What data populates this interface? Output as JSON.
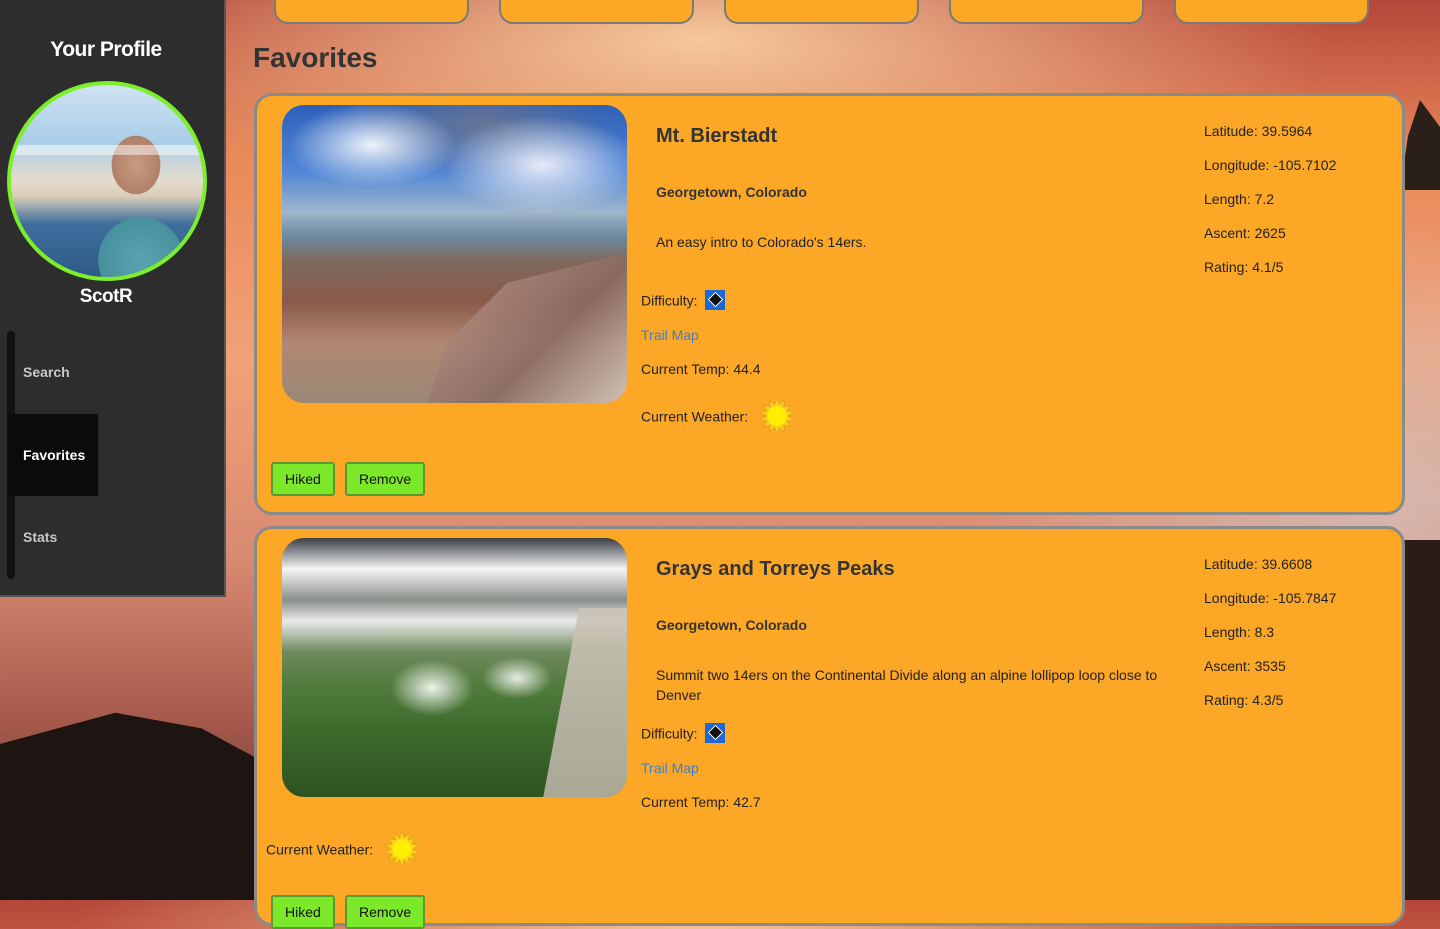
{
  "sidebar": {
    "title": "Your Profile",
    "username": "ScotR",
    "nav": [
      {
        "label": "Search"
      },
      {
        "label": "Favorites",
        "active": true
      },
      {
        "label": "Stats"
      }
    ]
  },
  "page_title": "Favorites",
  "colors": {
    "card_bg": "#fca726",
    "button_bg": "#7ce82a",
    "sidebar_bg": "#2d2d2d",
    "avatar_ring": "#7cee2a",
    "link": "#3a7fd1"
  },
  "labels": {
    "difficulty": "Difficulty:",
    "trail_map": "Trail Map",
    "current_temp": "Current Temp:",
    "current_weather": "Current Weather:",
    "latitude": "Latitude:",
    "longitude": "Longitude:",
    "length": "Length:",
    "ascent": "Ascent:",
    "rating": "Rating:",
    "hiked": "Hiked",
    "remove": "Remove"
  },
  "favorites": [
    {
      "name": "Mt. Bierstadt",
      "location": "Georgetown, Colorado",
      "description": "An easy intro to Colorado's 14ers.",
      "difficulty_icon": "black-diamond-icon",
      "temp": "44.4",
      "weather_icon": "sun-icon",
      "latitude": "39.5964",
      "longitude": "-105.7102",
      "length": "7.2",
      "ascent": "2625",
      "rating": "4.1/5"
    },
    {
      "name": "Grays and Torreys Peaks",
      "location": "Georgetown, Colorado",
      "description": "Summit two 14ers on the Continental Divide along an alpine lollipop loop close to Denver",
      "difficulty_icon": "black-diamond-icon",
      "temp": "42.7",
      "weather_icon": "sun-icon",
      "latitude": "39.6608",
      "longitude": "-105.7847",
      "length": "8.3",
      "ascent": "3535",
      "rating": "4.3/5"
    }
  ]
}
